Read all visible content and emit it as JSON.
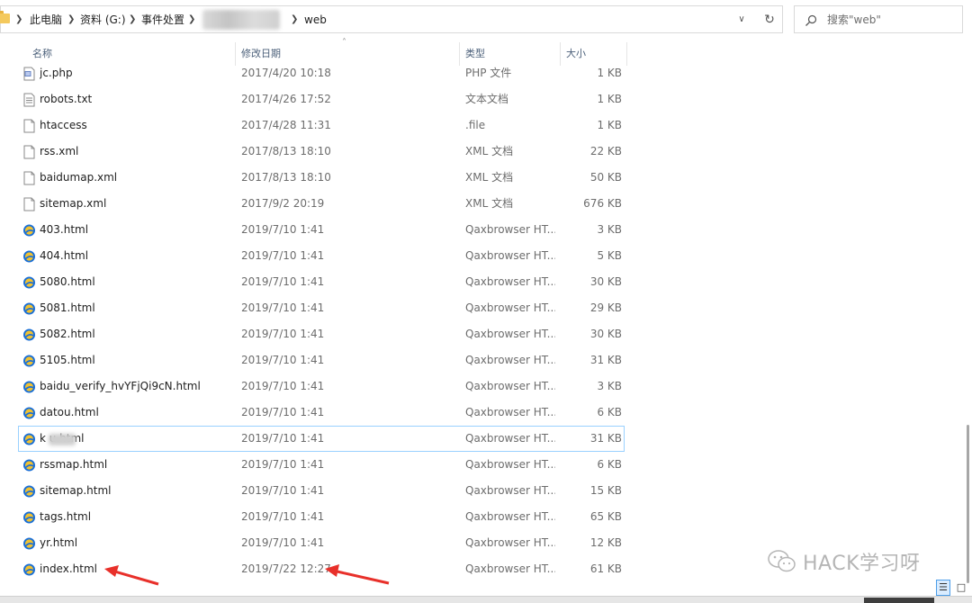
{
  "address_bar": {
    "crumbs": [
      "此电脑",
      "资料 (G:)",
      "事件处置",
      "web"
    ],
    "dropdown_icon": "chevron-down-icon",
    "refresh_icon": "refresh-icon"
  },
  "search": {
    "placeholder": "搜索\"web\"",
    "icon": "search-icon"
  },
  "columns": {
    "name": "名称",
    "date": "修改日期",
    "type": "类型",
    "size": "大小"
  },
  "files": [
    {
      "name": "jc.php",
      "date": "2017/4/20 10:18",
      "type": "PHP 文件",
      "size": "1 KB",
      "icon": "php-file-icon"
    },
    {
      "name": "robots.txt",
      "date": "2017/4/26 17:52",
      "type": "文本文档",
      "size": "1 KB",
      "icon": "text-file-icon"
    },
    {
      "name": "htaccess",
      "date": "2017/4/28 11:31",
      "type": ".file",
      "size": "1 KB",
      "icon": "blank-file-icon"
    },
    {
      "name": "rss.xml",
      "date": "2017/8/13 18:10",
      "type": "XML 文档",
      "size": "22 KB",
      "icon": "blank-file-icon"
    },
    {
      "name": "baidumap.xml",
      "date": "2017/8/13 18:10",
      "type": "XML 文档",
      "size": "50 KB",
      "icon": "blank-file-icon"
    },
    {
      "name": "sitemap.xml",
      "date": "2017/9/2 20:19",
      "type": "XML 文档",
      "size": "676 KB",
      "icon": "blank-file-icon"
    },
    {
      "name": "403.html",
      "date": "2019/7/10 1:41",
      "type": "Qaxbrowser HT...",
      "size": "3 KB",
      "icon": "browser-html-icon"
    },
    {
      "name": "404.html",
      "date": "2019/7/10 1:41",
      "type": "Qaxbrowser HT...",
      "size": "5 KB",
      "icon": "browser-html-icon"
    },
    {
      "name": "5080.html",
      "date": "2019/7/10 1:41",
      "type": "Qaxbrowser HT...",
      "size": "30 KB",
      "icon": "browser-html-icon"
    },
    {
      "name": "5081.html",
      "date": "2019/7/10 1:41",
      "type": "Qaxbrowser HT...",
      "size": "29 KB",
      "icon": "browser-html-icon"
    },
    {
      "name": "5082.html",
      "date": "2019/7/10 1:41",
      "type": "Qaxbrowser HT...",
      "size": "30 KB",
      "icon": "browser-html-icon"
    },
    {
      "name": "5105.html",
      "date": "2019/7/10 1:41",
      "type": "Qaxbrowser HT...",
      "size": "31 KB",
      "icon": "browser-html-icon"
    },
    {
      "name": "baidu_verify_hvYFjQi9cN.html",
      "date": "2019/7/10 1:41",
      "type": "Qaxbrowser HT...",
      "size": "3 KB",
      "icon": "browser-html-icon"
    },
    {
      "name": "datou.html",
      "date": "2019/7/10 1:41",
      "type": "Qaxbrowser HT...",
      "size": "6 KB",
      "icon": "browser-html-icon"
    },
    {
      "name": "k        u.html",
      "date": "2019/7/10 1:41",
      "type": "Qaxbrowser HT...",
      "size": "31 KB",
      "icon": "browser-html-icon",
      "selected": true,
      "blurred": true
    },
    {
      "name": "rssmap.html",
      "date": "2019/7/10 1:41",
      "type": "Qaxbrowser HT...",
      "size": "6 KB",
      "icon": "browser-html-icon"
    },
    {
      "name": "sitemap.html",
      "date": "2019/7/10 1:41",
      "type": "Qaxbrowser HT...",
      "size": "15 KB",
      "icon": "browser-html-icon"
    },
    {
      "name": "tags.html",
      "date": "2019/7/10 1:41",
      "type": "Qaxbrowser HT...",
      "size": "65 KB",
      "icon": "browser-html-icon"
    },
    {
      "name": "yr.html",
      "date": "2019/7/10 1:41",
      "type": "Qaxbrowser HT...",
      "size": "12 KB",
      "icon": "browser-html-icon"
    },
    {
      "name": "index.html",
      "date": "2019/7/22 12:27",
      "type": "Qaxbrowser HT...",
      "size": "61 KB",
      "icon": "browser-html-icon"
    }
  ],
  "watermark": {
    "text": "HACK学习呀",
    "icon": "wechat-icon"
  },
  "view_buttons": {
    "details_icon": "details-view-icon",
    "tiles_icon": "large-icons-view-icon"
  },
  "colors": {
    "selection_border": "#99d1ff",
    "arrow_red": "#e8302a",
    "header_text": "#4c607a",
    "folder_yellow": "#f4c95d"
  }
}
